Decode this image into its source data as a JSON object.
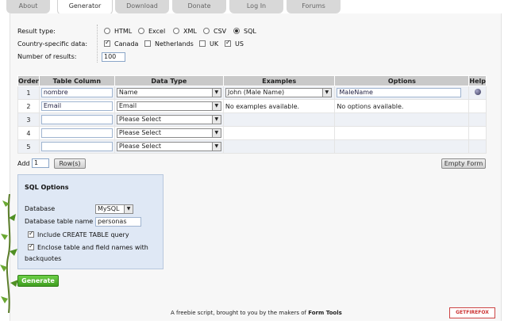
{
  "nav": {
    "tabs": [
      {
        "label": "About"
      },
      {
        "label": "Generator",
        "active": true
      },
      {
        "label": "Download"
      },
      {
        "label": "Donate"
      },
      {
        "label": "Log In"
      },
      {
        "label": "Forums"
      }
    ]
  },
  "settings": {
    "result_type_label": "Result type:",
    "result_types": [
      "HTML",
      "Excel",
      "XML",
      "CSV",
      "SQL"
    ],
    "selected_result_type": "SQL",
    "country_label": "Country-specific data:",
    "countries": [
      {
        "label": "Canada",
        "checked": true
      },
      {
        "label": "Netherlands",
        "checked": false
      },
      {
        "label": "UK",
        "checked": false
      },
      {
        "label": "US",
        "checked": true
      }
    ],
    "num_results_label": "Number of results:",
    "num_results_value": "100"
  },
  "table": {
    "headers": [
      "Order",
      "Table Column",
      "Data Type",
      "Examples",
      "Options",
      "Help"
    ],
    "rows": [
      {
        "order": "1",
        "column": "nombre",
        "data_type": "Name",
        "example": "John (Male Name)",
        "options": "MaleName",
        "has_help": true
      },
      {
        "order": "2",
        "column": "Email",
        "data_type": "Email",
        "example": "No examples available.",
        "options": "No options available.",
        "has_help": false
      },
      {
        "order": "3",
        "column": "",
        "data_type": "Please Select",
        "example": "",
        "options": "",
        "has_help": false
      },
      {
        "order": "4",
        "column": "",
        "data_type": "Please Select",
        "example": "",
        "options": "",
        "has_help": false
      },
      {
        "order": "5",
        "column": "",
        "data_type": "Please Select",
        "example": "",
        "options": "",
        "has_help": false
      }
    ]
  },
  "add_rows": {
    "label": "Add",
    "value": "1",
    "button_label": "Row(s)"
  },
  "empty_form_label": "Empty Form",
  "sql_options": {
    "title": "SQL Options",
    "database_label": "Database",
    "database_value": "MySQL",
    "table_name_label": "Database table name",
    "table_name_value": "personas",
    "include_create_label": "Include CREATE TABLE query",
    "include_create_checked": true,
    "enclose_label_1": "Enclose table and field names with",
    "enclose_label_2": "backquotes",
    "enclose_checked": true
  },
  "generate_label": "Generate",
  "footer": {
    "text": "A freebie script, brought to you by the makers of",
    "link": "Form Tools"
  },
  "badge_text": "GETFIREFOX",
  "icons": {
    "help": "help-icon",
    "dropdown": "chevron-down-icon",
    "ivy": "ivy-decoration-icon"
  },
  "colors": {
    "accent_green": "#4caf28",
    "header_gray": "#c9c9c9",
    "sql_box_bg": "#dfe8f5"
  }
}
